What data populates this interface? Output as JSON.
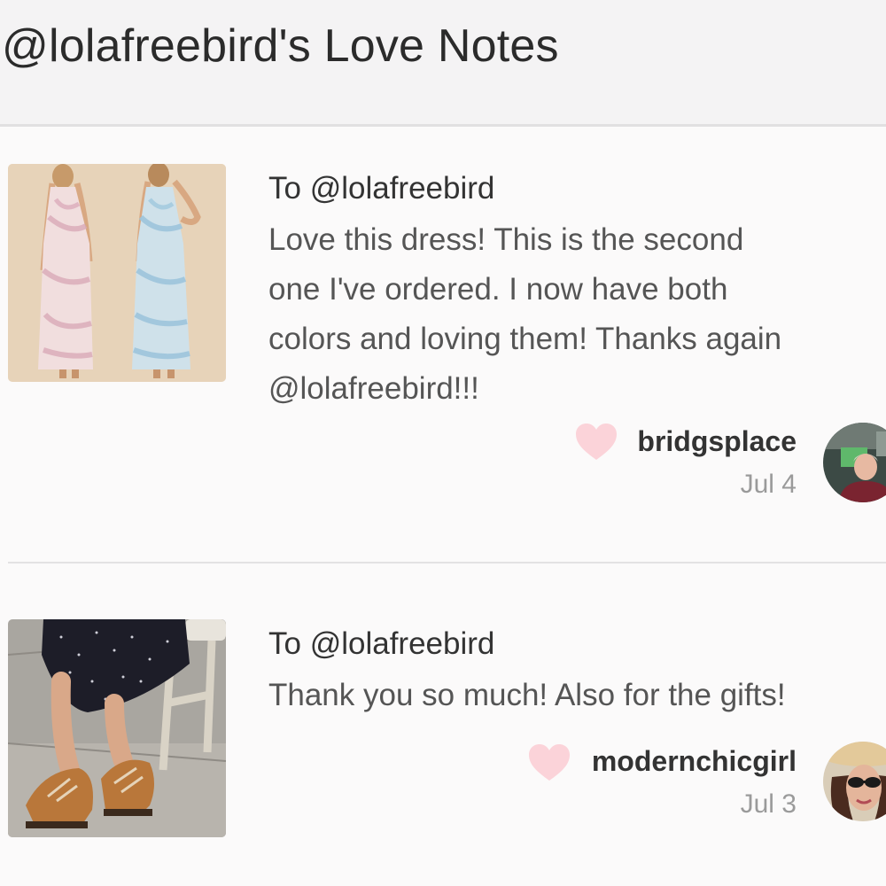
{
  "header": {
    "title": "@lolafreebird's Love Notes"
  },
  "notes": [
    {
      "recipient": "To @lolafreebird",
      "message_lines": [
        "Love this dress! This is the second",
        "one I've ordered. I now have both",
        "colors and loving them! Thanks again",
        "@lolafreebird!!!"
      ],
      "username": "bridgsplace",
      "date": "Jul 4",
      "thumbnail": "two tie-dye maxi dresses, pink and blue",
      "heart_color": "#fbd3d9"
    },
    {
      "recipient": "To @lolafreebird",
      "message_lines": [
        "Thank you so much! Also for the gifts!"
      ],
      "username": "modernchicgirl",
      "date": "Jul 3",
      "thumbnail": "tan lace-up wedge sandals with polka dot skirt",
      "heart_color": "#fbd3d9"
    }
  ],
  "colors": {
    "header_bg": "#f4f3f4",
    "page_bg": "#fbfafa",
    "heart": "#fbd3d9",
    "date_text": "#9a9a9a"
  }
}
